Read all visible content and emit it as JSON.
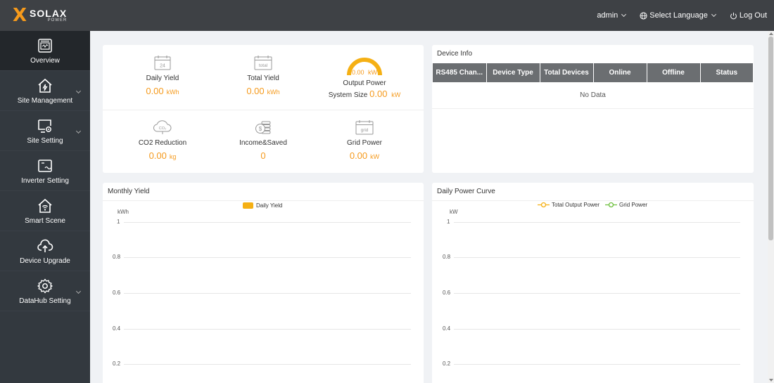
{
  "brand": {
    "name": "SOLAX",
    "sub": "POWER"
  },
  "topbar": {
    "user": "admin",
    "language": "Select Language",
    "logout": "Log Out"
  },
  "sidebar": {
    "items": [
      {
        "label": "Overview",
        "icon": "overview-icon",
        "active": true,
        "has_arrow": false
      },
      {
        "label": "Site Management",
        "icon": "home-bolt-icon",
        "has_arrow": true
      },
      {
        "label": "Site Setting",
        "icon": "monitor-gear-icon",
        "has_arrow": true
      },
      {
        "label": "Inverter Setting",
        "icon": "inverter-icon",
        "has_arrow": false
      },
      {
        "label": "Smart Scene",
        "icon": "smart-home-icon",
        "has_arrow": false
      },
      {
        "label": "Device Upgrade",
        "icon": "cloud-upload-icon",
        "has_arrow": false
      },
      {
        "label": "DataHub Setting",
        "icon": "gear-icon",
        "has_arrow": true
      }
    ]
  },
  "stats": {
    "daily_yield": {
      "label": "Daily Yield",
      "value": "0.00",
      "unit": "kWh",
      "icon_text": "24"
    },
    "total_yield": {
      "label": "Total Yield",
      "value": "0.00",
      "unit": "kWh",
      "icon_text": "total"
    },
    "output_power": {
      "label": "Output Power",
      "gauge_value": "0.00",
      "gauge_unit": "kW",
      "system_size_label": "System Size",
      "system_size_value": "0.00",
      "system_size_unit": "kW"
    },
    "co2": {
      "label": "CO2 Reduction",
      "value": "0.00",
      "unit": "kg",
      "icon_text": "CO₂"
    },
    "income": {
      "label": "Income&Saved",
      "value": "0"
    },
    "grid_power": {
      "label": "Grid Power",
      "value": "0.00",
      "unit": "kW",
      "icon_text": "grid"
    }
  },
  "device_info": {
    "title": "Device Info",
    "columns": [
      "RS485 Chan...",
      "Device Type",
      "Total Devices",
      "Online",
      "Offline",
      "Status"
    ],
    "empty_text": "No Data"
  },
  "monthly_yield": {
    "title": "Monthly Yield",
    "legend": "Daily Yield",
    "unit": "kWh",
    "ticks": [
      "1",
      "0.8",
      "0.6",
      "0.4",
      "0.2"
    ]
  },
  "daily_power": {
    "title": "Daily Power Curve",
    "legend_a": "Total Output Power",
    "legend_b": "Grid Power",
    "unit": "kW",
    "ticks": [
      "1",
      "0.8",
      "0.6",
      "0.4",
      "0.2"
    ]
  },
  "colors": {
    "accent": "#f59a1c",
    "grid_green": "#6cbf3c",
    "sidebar": "#33393f",
    "topbar": "#3e4145"
  }
}
